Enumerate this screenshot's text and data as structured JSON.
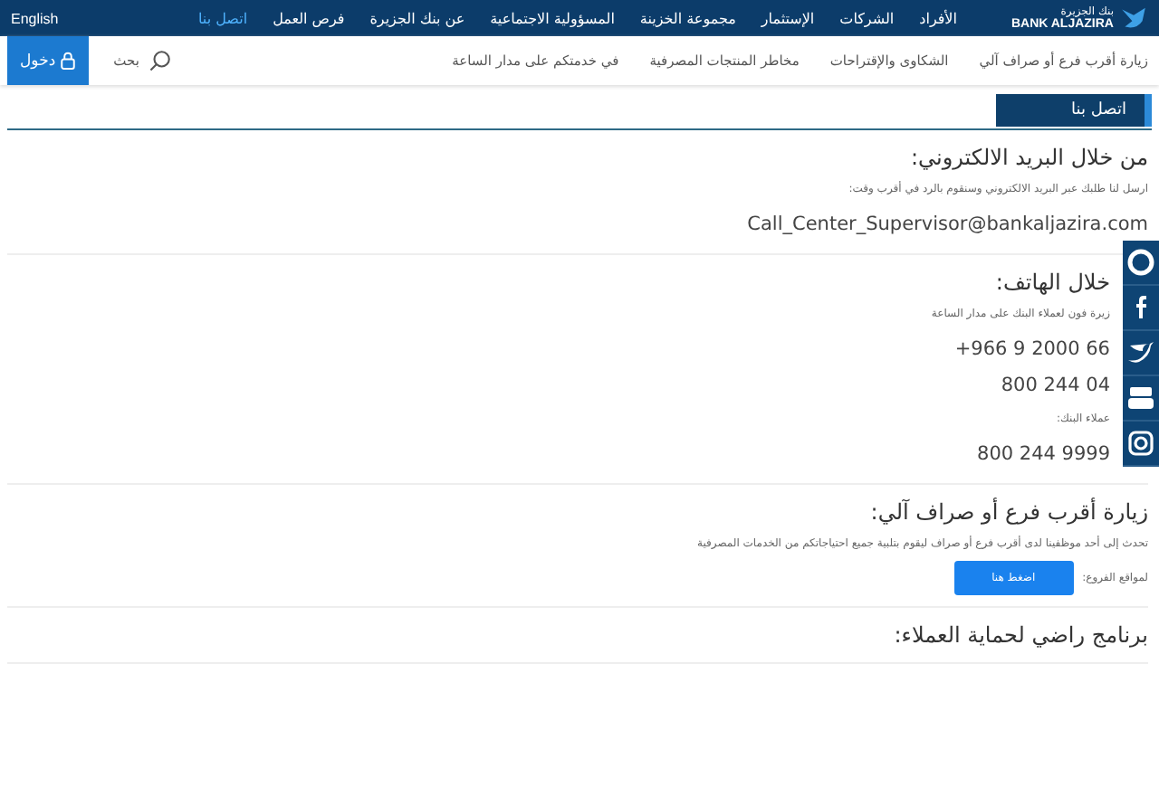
{
  "logo": {
    "arabic": "بنك الجزيرة",
    "latin": "BANK ALJAZIRA"
  },
  "top_nav": {
    "items": [
      {
        "label": "الأفراد",
        "selected": false
      },
      {
        "label": "الشركات",
        "selected": false
      },
      {
        "label": "الإستثمار",
        "selected": false
      },
      {
        "label": "مجموعة الخزينة",
        "selected": false
      },
      {
        "label": "المسؤولية الاجتماعية",
        "selected": false
      },
      {
        "label": "عن بنك الجزيرة",
        "selected": false
      },
      {
        "label": "فرص العمل",
        "selected": false
      },
      {
        "label": "اتصل بنا",
        "selected": true
      }
    ],
    "language": "English"
  },
  "sub_nav": {
    "items": [
      "زيارة أقرب فرع أو صراف آلي",
      "الشكاوى والإقتراحات",
      "مخاطر المنتجات المصرفية",
      "في خدمتكم على مدار الساعة"
    ],
    "search_label": "بحث",
    "login": "دخول"
  },
  "page_title": "اتصل بنا",
  "sections": [
    {
      "heading": "من خلال البريد الالكتروني:",
      "covered": false,
      "items": [
        {
          "kind": "note",
          "text": "ارسل لنا طلبك عبر البريد الالكتروني وسنقوم بالرد في أقرب وقت:"
        },
        {
          "kind": "value",
          "text": "Call_Center_Supervisor@bankaljazira.com"
        }
      ]
    },
    {
      "heading": "خلال الهاتف:",
      "covered": true,
      "items": [
        {
          "kind": "note",
          "text": "زيرة فون لعملاء البنك على مدار الساعة"
        },
        {
          "kind": "value",
          "text": "+966 9 2000 66"
        },
        {
          "kind": "value",
          "text": "800 244 04"
        },
        {
          "kind": "note",
          "text": "عملاء البنك:"
        },
        {
          "kind": "value",
          "text": "800 244 9999"
        }
      ]
    },
    {
      "heading": "زيارة أقرب فرع أو صراف آلي:",
      "covered": false,
      "items": [
        {
          "kind": "note",
          "text": "تحدث إلى أحد موظفينا لدى أقرب فرع أو صراف ليقوم بتلبية جميع احتياجاتكم من الخدمات المصرفية"
        },
        {
          "kind": "action",
          "text": "لمواقع الفروع:",
          "button": "اضغط هنا"
        }
      ]
    },
    {
      "heading": "برنامج راضي لحماية العملاء:",
      "covered": false
    }
  ]
}
